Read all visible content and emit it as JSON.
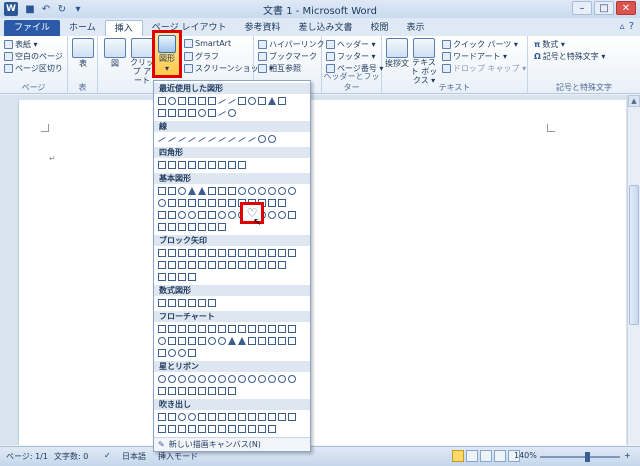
{
  "window": {
    "title": "文書 1 - Microsoft Word",
    "app_icon_letter": "W",
    "controls": [
      "–",
      "□",
      "✕"
    ]
  },
  "tabs": [
    {
      "label": "ファイル",
      "active": false
    },
    {
      "label": "ホーム",
      "active": false
    },
    {
      "label": "挿入",
      "active": true
    },
    {
      "label": "ページ レイアウト",
      "active": false
    },
    {
      "label": "参考資料",
      "active": false
    },
    {
      "label": "差し込み文書",
      "active": false
    },
    {
      "label": "校閲",
      "active": false
    },
    {
      "label": "表示",
      "active": false
    }
  ],
  "ribbon": {
    "page_group": {
      "label": "ページ",
      "items": [
        "表紙 ▾",
        "空白のページ",
        "ページ区切り"
      ]
    },
    "table_group": {
      "label": "表",
      "button": "表"
    },
    "illustrations": {
      "picture": "図",
      "clipart": "クリップ\nアート",
      "shapes": "図形",
      "smartart": "SmartArt",
      "chart": "グラフ",
      "screenshot": "スクリーンショット ▾"
    },
    "links": {
      "hyperlink": "ハイパーリンク",
      "bookmark": "ブックマーク",
      "crossref": "相互参照"
    },
    "header_footer": {
      "label": "ヘッダーとフッター",
      "header": "ヘッダー ▾",
      "footer": "フッター ▾",
      "page_number": "ページ番号 ▾"
    },
    "text": {
      "label": "テキスト",
      "greeting": "挨拶文",
      "textbox": "テキスト\nボックス ▾",
      "quickparts": "クイック パーツ ▾",
      "wordart": "ワードアート ▾",
      "dropcap": "ドロップ キャップ ▾"
    },
    "symbols": {
      "label": "記号と特殊文字",
      "equation": "数式 ▾",
      "symbol": "記号と特殊文字 ▾"
    }
  },
  "shapes_menu": {
    "sections": [
      "最近使用した図形",
      "線",
      "四角形",
      "基本図形",
      "ブロック矢印",
      "数式図形",
      "フローチャート",
      "星とリボン",
      "吹き出し"
    ],
    "footer": "新しい描画キャンバス(N)",
    "highlighted_shape_icon": "♡"
  },
  "statusbar": {
    "page": "ページ: 1/1",
    "words": "文字数: 0",
    "language": "日本語",
    "mode": "挿入モード",
    "zoom": "140%"
  }
}
